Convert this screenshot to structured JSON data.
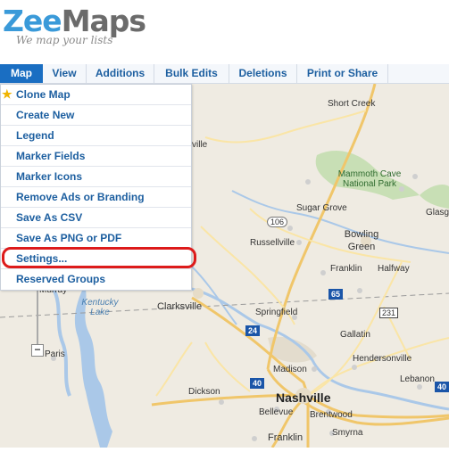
{
  "app": {
    "logo_part1": "Zee",
    "logo_part2": "Maps",
    "tagline": "We map your lists"
  },
  "menubar": {
    "tabs": [
      "Map",
      "View",
      "Additions",
      "Bulk Edits",
      "Deletions",
      "Print or Share"
    ],
    "active": "Map"
  },
  "dropdown": {
    "items": [
      "Clone Map",
      "Create New",
      "Legend",
      "Marker Fields",
      "Marker Icons",
      "Remove Ads or Branding",
      "Save As CSV",
      "Save As PNG or PDF",
      "Settings...",
      "Reserved Groups"
    ],
    "starred": "Clone Map",
    "highlighted": "Settings..."
  },
  "map": {
    "places": [
      "Short Creek",
      "ville",
      "Mammoth Cave National Park",
      "Glasgow",
      "Sugar Grove",
      "Russellville",
      "Bowling Green",
      "Franklin",
      "Halfway",
      "Murray",
      "Kentucky Lake",
      "Clarksville",
      "Springfield",
      "Gallatin",
      "Paris",
      "Hendersonville",
      "Madison",
      "Lebanon",
      "Dickson",
      "Nashville",
      "Bellevue",
      "Brentwood",
      "Smyrna",
      "Franklin"
    ],
    "highways": [
      "106",
      "65",
      "24",
      "231",
      "40",
      "40"
    ],
    "zoom_out_label": "−"
  },
  "colors": {
    "accent": "#1a6ec2",
    "highlight": "#dd1b1b",
    "logo_blue": "#3a9ad9"
  }
}
